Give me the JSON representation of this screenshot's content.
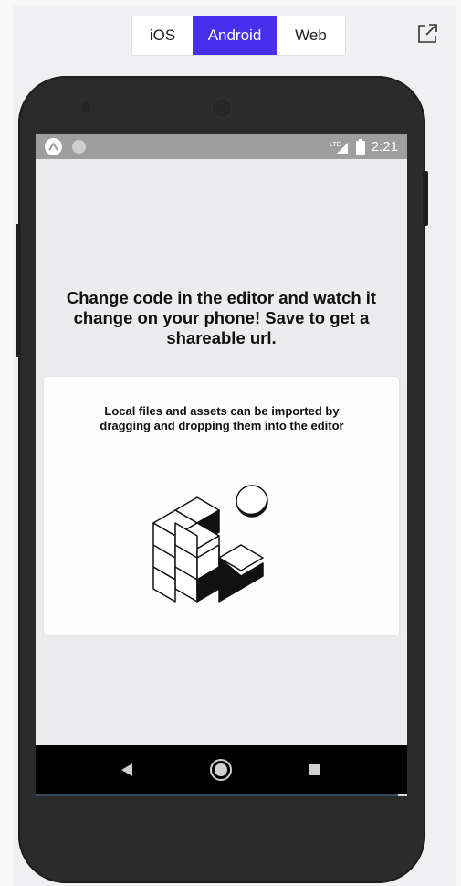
{
  "platform_selector": {
    "tabs": [
      {
        "label": "iOS",
        "active": false
      },
      {
        "label": "Android",
        "active": true
      },
      {
        "label": "Web",
        "active": false
      }
    ],
    "active_color": "#4630eb"
  },
  "toolbar": {
    "open_external_icon": "external-link-icon"
  },
  "device": {
    "status_bar": {
      "left_icons": [
        "app-notification-icon",
        "circle-indicator-icon"
      ],
      "signal_label": "LTE",
      "right_icons": [
        "signal-icon",
        "battery-icon"
      ],
      "time": "2:21"
    },
    "headline": "Change code in the editor and watch it change on your phone! Save to get a shareable url.",
    "card": {
      "text": "Local files and assets can be imported by dragging and dropping them into the editor",
      "illustration_icon": "cubes-and-ball-icon"
    },
    "nav_bar": {
      "buttons": [
        "back-triangle-icon",
        "home-circle-icon",
        "recents-square-icon"
      ]
    }
  }
}
